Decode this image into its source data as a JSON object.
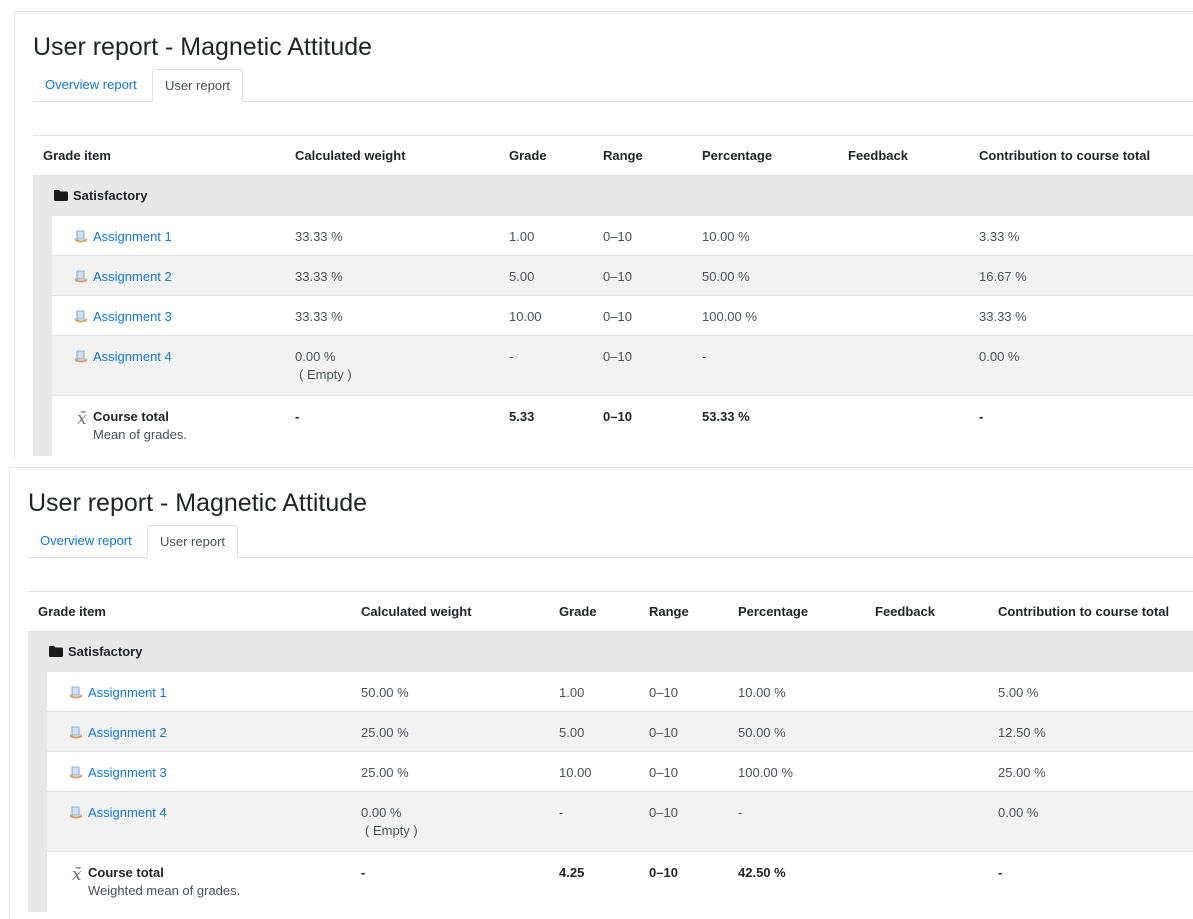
{
  "reports": [
    {
      "title": "User report - Magnetic Attitude",
      "tabs": [
        {
          "label": "Overview report",
          "active": false
        },
        {
          "label": "User report",
          "active": true
        }
      ],
      "columns": [
        "Grade item",
        "Calculated weight",
        "Grade",
        "Range",
        "Percentage",
        "Feedback",
        "Contribution to course total"
      ],
      "category": {
        "icon": "folder-icon",
        "label": "Satisfactory"
      },
      "items": [
        {
          "name": "Assignment 1",
          "weight": "33.33 %",
          "weight_note": "",
          "grade": "1.00",
          "range": "0–10",
          "percentage": "10.00 %",
          "feedback": "",
          "contribution": "3.33 %"
        },
        {
          "name": "Assignment 2",
          "weight": "33.33 %",
          "weight_note": "",
          "grade": "5.00",
          "range": "0–10",
          "percentage": "50.00 %",
          "feedback": "",
          "contribution": "16.67 %"
        },
        {
          "name": "Assignment 3",
          "weight": "33.33 %",
          "weight_note": "",
          "grade": "10.00",
          "range": "0–10",
          "percentage": "100.00 %",
          "feedback": "",
          "contribution": "33.33 %"
        },
        {
          "name": "Assignment 4",
          "weight": "0.00 %",
          "weight_note": "( Empty )",
          "grade": "-",
          "range": "0–10",
          "percentage": "-",
          "feedback": "",
          "contribution": "0.00 %"
        }
      ],
      "total": {
        "label": "Course total",
        "note": "Mean of grades.",
        "weight": "-",
        "grade": "5.33",
        "range": "0–10",
        "percentage": "53.33 %",
        "contribution": "-"
      }
    },
    {
      "title": "User report - Magnetic Attitude",
      "tabs": [
        {
          "label": "Overview report",
          "active": false
        },
        {
          "label": "User report",
          "active": true
        }
      ],
      "columns": [
        "Grade item",
        "Calculated weight",
        "Grade",
        "Range",
        "Percentage",
        "Feedback",
        "Contribution to course total"
      ],
      "category": {
        "icon": "folder-icon",
        "label": "Satisfactory"
      },
      "items": [
        {
          "name": "Assignment 1",
          "weight": "50.00 %",
          "weight_note": "",
          "grade": "1.00",
          "range": "0–10",
          "percentage": "10.00 %",
          "feedback": "",
          "contribution": "5.00 %"
        },
        {
          "name": "Assignment 2",
          "weight": "25.00 %",
          "weight_note": "",
          "grade": "5.00",
          "range": "0–10",
          "percentage": "50.00 %",
          "feedback": "",
          "contribution": "12.50 %"
        },
        {
          "name": "Assignment 3",
          "weight": "25.00 %",
          "weight_note": "",
          "grade": "10.00",
          "range": "0–10",
          "percentage": "100.00 %",
          "feedback": "",
          "contribution": "25.00 %"
        },
        {
          "name": "Assignment 4",
          "weight": "0.00 %",
          "weight_note": "( Empty )",
          "grade": "-",
          "range": "0–10",
          "percentage": "-",
          "feedback": "",
          "contribution": "0.00 %"
        }
      ],
      "total": {
        "label": "Course total",
        "note": "Weighted mean of grades.",
        "weight": "-",
        "grade": "4.25",
        "range": "0–10",
        "percentage": "42.50 %",
        "contribution": "-"
      }
    }
  ]
}
